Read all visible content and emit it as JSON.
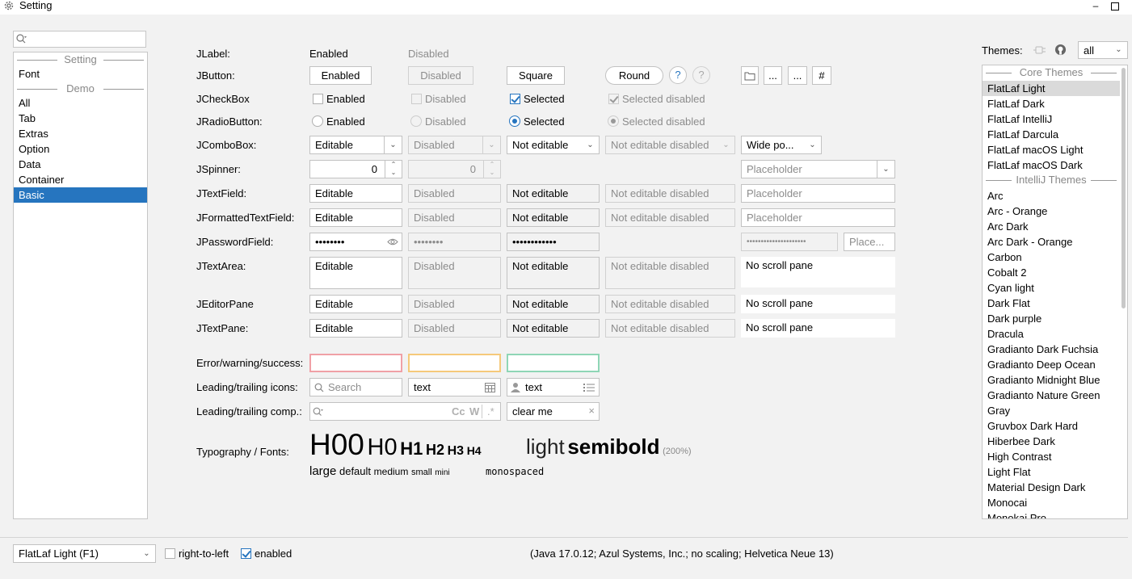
{
  "window": {
    "title": "Setting",
    "icon": "gear-icon",
    "minimize": "–",
    "maximize": "☐"
  },
  "sidebar": {
    "search_placeholder": "",
    "items": [
      {
        "label": "Setting",
        "separator": true
      },
      {
        "label": "Font"
      },
      {
        "label": "Demo",
        "separator": true
      },
      {
        "label": "All"
      },
      {
        "label": "Tab"
      },
      {
        "label": "Extras"
      },
      {
        "label": "Option"
      },
      {
        "label": "Data"
      },
      {
        "label": "Container"
      },
      {
        "label": "Basic",
        "selected": true
      }
    ]
  },
  "form": {
    "labels": {
      "jlabel": "JLabel:",
      "jbutton": "JButton:",
      "jcheckbox": "JCheckBox",
      "jradiobutton": "JRadioButton:",
      "jcombobox": "JComboBox:",
      "jspinner": "JSpinner:",
      "jtextfield": "JTextField:",
      "jformatted": "JFormattedTextField:",
      "jpassword": "JPasswordField:",
      "jtextarea": "JTextArea:",
      "jeditorpane": "JEditorPane",
      "jtextpane": "JTextPane:",
      "errwarn": "Error/warning/success:",
      "leadicons": "Leading/trailing icons:",
      "leadcomp": "Leading/trailing comp.:",
      "typo": "Typography / Fonts:"
    },
    "jlabel": {
      "enabled": "Enabled",
      "disabled": "Disabled"
    },
    "jbutton": {
      "enabled": "Enabled",
      "disabled": "Disabled",
      "square": "Square",
      "round": "Round",
      "help": "?",
      "ellipsis": "...",
      "hash": "#"
    },
    "jcheckbox": {
      "enabled": "Enabled",
      "disabled": "Disabled",
      "selected": "Selected",
      "selected_disabled": "Selected disabled"
    },
    "jradio": {
      "enabled": "Enabled",
      "disabled": "Disabled",
      "selected": "Selected",
      "selected_disabled": "Selected disabled"
    },
    "jcombo": {
      "editable": "Editable",
      "disabled": "Disabled",
      "not_editable": "Not editable",
      "not_editable_disabled": "Not editable disabled",
      "wide": "Wide po..."
    },
    "jspinner": {
      "value": "0",
      "disabled_value": "0",
      "placeholder": "Placeholder"
    },
    "jtextfield": {
      "editable": "Editable",
      "disabled": "Disabled",
      "not_editable": "Not editable",
      "not_editable_disabled": "Not editable disabled",
      "placeholder": "Placeholder"
    },
    "jformatted": {
      "editable": "Editable",
      "disabled": "Disabled",
      "not_editable": "Not editable",
      "not_editable_disabled": "Not editable disabled",
      "placeholder": "Placeholder"
    },
    "jpassword": {
      "editable": "••••••••",
      "disabled": "••••••••",
      "not_editable": "••••••••••••",
      "wide": "•••••••••••••••••••••",
      "placeholder": "Place..."
    },
    "jtextarea": {
      "editable": "Editable",
      "disabled": "Disabled",
      "not_editable": "Not editable",
      "not_editable_disabled": "Not editable disabled",
      "no_scroll": "No scroll pane"
    },
    "jeditorpane": {
      "editable": "Editable",
      "disabled": "Disabled",
      "not_editable": "Not editable",
      "not_editable_disabled": "Not editable disabled",
      "no_scroll": "No scroll pane"
    },
    "jtextpane": {
      "editable": "Editable",
      "disabled": "Disabled",
      "not_editable": "Not editable",
      "not_editable_disabled": "Not editable disabled",
      "no_scroll": "No scroll pane"
    },
    "leadicons": {
      "search": "Search",
      "text1": "text",
      "text2": "text"
    },
    "leadcomp": {
      "cc": "Cc",
      "w": "W",
      "star": ".*",
      "clear": "clear me"
    },
    "typo": {
      "h00": "H00",
      "h0": "H0",
      "h1": "H1",
      "h2": "H2",
      "h3": "H3",
      "h4": "H4",
      "light": "light",
      "semibold": "semibold",
      "pct": "(200%)",
      "large": "large",
      "default": "default",
      "medium": "medium",
      "small": "small",
      "mini": "mini",
      "mono": "monospaced"
    },
    "colors": {
      "error": "#f0a0a6",
      "warning": "#f5c97a",
      "success": "#8fd6b6",
      "accent": "#2675bf"
    }
  },
  "themes": {
    "label": "Themes:",
    "filter": "all",
    "items": [
      {
        "label": "Core Themes",
        "separator": true
      },
      {
        "label": "FlatLaf Light",
        "selected": true
      },
      {
        "label": "FlatLaf Dark"
      },
      {
        "label": "FlatLaf IntelliJ"
      },
      {
        "label": "FlatLaf Darcula"
      },
      {
        "label": "FlatLaf macOS Light"
      },
      {
        "label": "FlatLaf macOS Dark"
      },
      {
        "label": "IntelliJ Themes",
        "separator": true
      },
      {
        "label": "Arc"
      },
      {
        "label": "Arc - Orange"
      },
      {
        "label": "Arc Dark"
      },
      {
        "label": "Arc Dark - Orange"
      },
      {
        "label": "Carbon"
      },
      {
        "label": "Cobalt 2"
      },
      {
        "label": "Cyan light"
      },
      {
        "label": "Dark Flat"
      },
      {
        "label": "Dark purple"
      },
      {
        "label": "Dracula"
      },
      {
        "label": "Gradianto Dark Fuchsia"
      },
      {
        "label": "Gradianto Deep Ocean"
      },
      {
        "label": "Gradianto Midnight Blue"
      },
      {
        "label": "Gradianto Nature Green"
      },
      {
        "label": "Gray"
      },
      {
        "label": "Gruvbox Dark Hard"
      },
      {
        "label": "Hiberbee Dark"
      },
      {
        "label": "High Contrast"
      },
      {
        "label": "Light Flat"
      },
      {
        "label": "Material Design Dark"
      },
      {
        "label": "Monocai"
      },
      {
        "label": "Monokai Pro"
      }
    ]
  },
  "footer": {
    "laf_select": "FlatLaf Light (F1)",
    "rtl": "right-to-left",
    "enabled": "enabled",
    "info": "(Java 17.0.12; Azul Systems, Inc.; no scaling; Helvetica Neue 13)"
  }
}
